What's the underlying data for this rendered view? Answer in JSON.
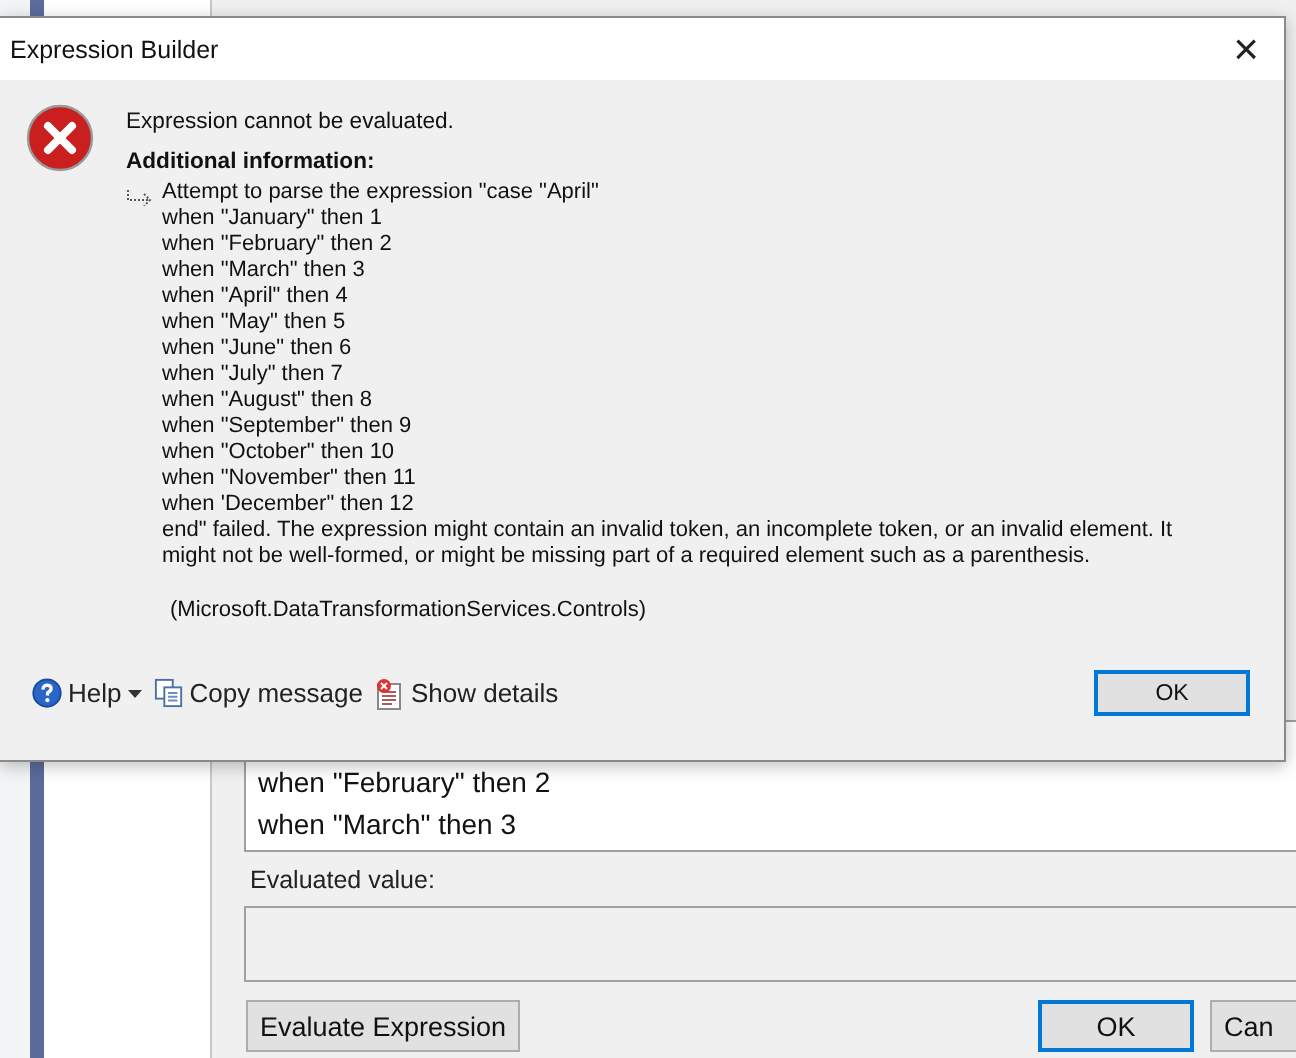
{
  "background_window": {
    "expression_lines": [
      "when \"February\" then 2",
      "when \"March\" then 3"
    ],
    "evaluated_label": "Evaluated value:",
    "buttons": [
      {
        "label": "Evaluate Expression",
        "kind": "plain"
      },
      {
        "label": "OK",
        "kind": "default"
      },
      {
        "label": "Can",
        "kind": "plain"
      }
    ]
  },
  "dialog": {
    "title": "Expression Builder",
    "close": "×",
    "message": "Expression cannot be evaluated.",
    "additional_heading": "Additional information:",
    "details": [
      "Attempt to parse the expression \"case \"April\"",
      "when \"January\" then 1",
      "when \"February\" then 2",
      "when \"March\" then 3",
      "when \"April\" then 4",
      "when \"May\" then 5",
      "when \"June\" then 6",
      "when \"July\" then 7",
      "when \"August\" then 8",
      "when \"September\" then 9",
      "when \"October\" then 10",
      "when \"November\" then 11",
      "when 'December\" then 12"
    ],
    "failure": "end\" failed. The expression might contain an invalid token, an incomplete token, or an invalid element. It might not be well-formed, or might be missing part of a required element such as a parenthesis.",
    "source": "(Microsoft.DataTransformationServices.Controls)",
    "footer": {
      "help": "Help",
      "copy": "Copy message",
      "show_details": "Show details",
      "ok": "OK"
    }
  }
}
